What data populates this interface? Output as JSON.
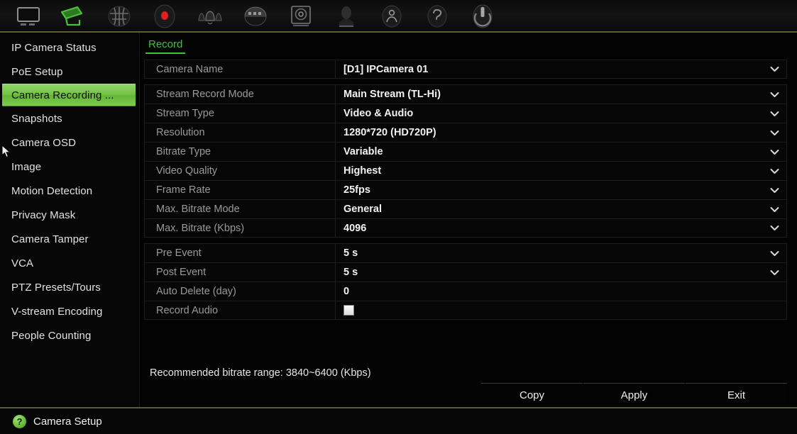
{
  "toolbar": {
    "items": [
      {
        "icon": "live-view-monitor-icon",
        "active": false
      },
      {
        "icon": "camera-setup-camcorder-icon",
        "active": true
      },
      {
        "icon": "network-settings-globe-icon",
        "active": false
      },
      {
        "icon": "recording-schedule-rec-dot-icon",
        "active": false
      },
      {
        "icon": "alarm-bells-icon",
        "active": false
      },
      {
        "icon": "playback-calendar-icon",
        "active": false
      },
      {
        "icon": "storage-hdd-icon",
        "active": false
      },
      {
        "icon": "system-settings-icon",
        "active": false
      },
      {
        "icon": "user-management-person-icon",
        "active": false
      },
      {
        "icon": "help-question-icon",
        "active": false
      },
      {
        "icon": "shutdown-power-icon",
        "active": false
      }
    ]
  },
  "sidebar": {
    "items": [
      {
        "label": "IP Camera Status",
        "selected": false
      },
      {
        "label": "PoE Setup",
        "selected": false
      },
      {
        "label": "Camera Recording ...",
        "selected": true
      },
      {
        "label": "Snapshots",
        "selected": false
      },
      {
        "label": "Camera OSD",
        "selected": false
      },
      {
        "label": "Image",
        "selected": false
      },
      {
        "label": "Motion Detection",
        "selected": false
      },
      {
        "label": "Privacy Mask",
        "selected": false
      },
      {
        "label": "Camera Tamper",
        "selected": false
      },
      {
        "label": "VCA",
        "selected": false
      },
      {
        "label": "PTZ Presets/Tours",
        "selected": false
      },
      {
        "label": "V-stream Encoding",
        "selected": false
      },
      {
        "label": "People Counting",
        "selected": false
      }
    ]
  },
  "main": {
    "tabs": [
      {
        "label": "Record",
        "active": true
      }
    ],
    "groups": [
      {
        "rows": [
          {
            "label": "Camera Name",
            "value": "[D1] IPCamera 01",
            "control": "dropdown"
          }
        ]
      },
      {
        "rows": [
          {
            "label": "Stream Record Mode",
            "value": "Main Stream (TL-Hi)",
            "control": "dropdown"
          },
          {
            "label": "Stream Type",
            "value": "Video & Audio",
            "control": "dropdown"
          },
          {
            "label": "Resolution",
            "value": "1280*720 (HD720P)",
            "control": "dropdown"
          },
          {
            "label": "Bitrate Type",
            "value": "Variable",
            "control": "dropdown"
          },
          {
            "label": "Video Quality",
            "value": "Highest",
            "control": "dropdown"
          },
          {
            "label": "Frame Rate",
            "value": "25fps",
            "control": "dropdown"
          },
          {
            "label": "Max. Bitrate Mode",
            "value": "General",
            "control": "dropdown"
          },
          {
            "label": "Max. Bitrate (Kbps)",
            "value": "4096",
            "control": "dropdown"
          }
        ]
      },
      {
        "rows": [
          {
            "label": "Pre Event",
            "value": "5 s",
            "control": "dropdown"
          },
          {
            "label": "Post Event",
            "value": "5 s",
            "control": "dropdown"
          },
          {
            "label": "Auto Delete (day)",
            "value": "0",
            "control": "text"
          },
          {
            "label": "Record Audio",
            "value": "",
            "control": "checkbox",
            "checked": false
          }
        ]
      }
    ],
    "hint": "Recommended bitrate range: 3840~6400 (Kbps)",
    "buttons": [
      {
        "label": "Copy"
      },
      {
        "label": "Apply"
      },
      {
        "label": "Exit"
      }
    ]
  },
  "statusbar": {
    "help_glyph": "?",
    "text": "Camera Setup"
  },
  "colors": {
    "accent_green": "#3fc03f",
    "selected_green": "#72c442",
    "divider_olive": "#5c5c38",
    "label_grey": "#9a9a9a",
    "value_white": "#f2f2f2",
    "background": "#050505"
  }
}
